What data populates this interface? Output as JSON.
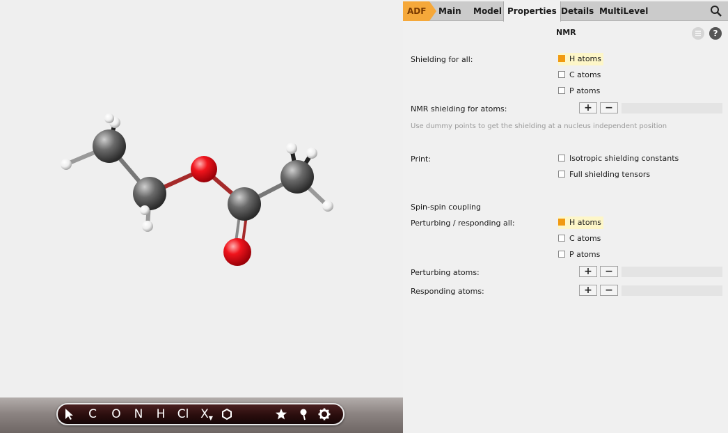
{
  "panel": {
    "tabs": [
      "ADF",
      "Main",
      "Model",
      "Properties",
      "Details",
      "MultiLevel"
    ],
    "active_tab": "Properties",
    "section_title": "NMR",
    "help_label": "?",
    "shielding": {
      "label": "Shielding for all:",
      "options": [
        {
          "label": "H atoms",
          "checked": true
        },
        {
          "label": "C atoms",
          "checked": false
        },
        {
          "label": "P atoms",
          "checked": false
        }
      ]
    },
    "nmr_shielding_atoms_label": "NMR shielding for atoms:",
    "dummy_hint": "Use dummy points to get the shielding at a nucleus independent position",
    "print": {
      "label": "Print:",
      "options": [
        {
          "label": "Isotropic shielding constants",
          "checked": false
        },
        {
          "label": "Full shielding tensors",
          "checked": false
        }
      ]
    },
    "spin_spin_label": "Spin-spin coupling",
    "perturbing_all": {
      "label": "Perturbing / responding all:",
      "options": [
        {
          "label": "H atoms",
          "checked": true
        },
        {
          "label": "C atoms",
          "checked": false
        },
        {
          "label": "P atoms",
          "checked": false
        }
      ]
    },
    "perturbing_atoms_label": "Perturbing atoms:",
    "responding_atoms_label": "Responding atoms:",
    "plus_label": "+",
    "minus_label": "−"
  },
  "toolbar": {
    "items": [
      {
        "icon": "pointer-icon"
      },
      {
        "label": "C"
      },
      {
        "label": "O"
      },
      {
        "label": "N"
      },
      {
        "label": "H"
      },
      {
        "label": "Cl"
      },
      {
        "label": "X"
      },
      {
        "icon": "hexagon-ring-icon"
      },
      {
        "icon": "star-icon"
      },
      {
        "icon": "pin-icon"
      },
      {
        "icon": "gear-icon"
      }
    ]
  },
  "colors": {
    "adf_tab": "#f5a83a",
    "checked": "#f19a10",
    "carbon": "#4a4a4a",
    "oxygen": "#e8141c",
    "hydrogen": "#ffffff",
    "toolbar_bg": "#2a0d0d"
  }
}
